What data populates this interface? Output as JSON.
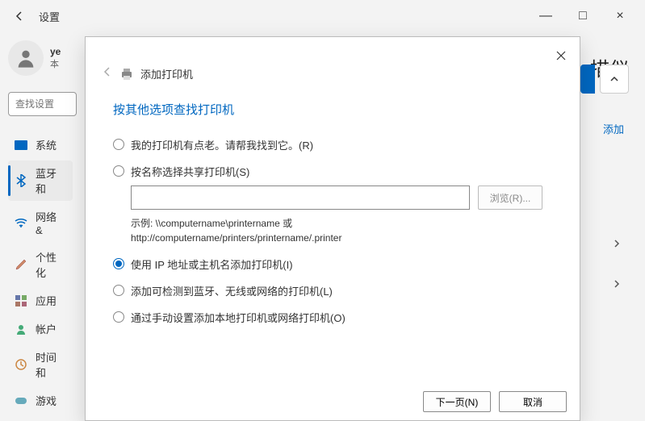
{
  "window": {
    "back_aria": "返回",
    "title": "设置",
    "minimize": "—",
    "maximize": "□",
    "close": "×"
  },
  "user": {
    "name_partial": "ye",
    "sub_partial": "本"
  },
  "search": {
    "placeholder": "查找设置"
  },
  "sidebar": {
    "items": [
      {
        "label": "系统",
        "icon": "system"
      },
      {
        "label": "蓝牙和",
        "icon": "bluetooth",
        "active": true
      },
      {
        "label": "网络 &",
        "icon": "wifi"
      },
      {
        "label": "个性化",
        "icon": "brush"
      },
      {
        "label": "应用",
        "icon": "apps"
      },
      {
        "label": "帐户",
        "icon": "account"
      },
      {
        "label": "时间和",
        "icon": "time"
      },
      {
        "label": "游戏",
        "icon": "game"
      }
    ]
  },
  "right": {
    "title_partial": "描仪",
    "add_label": "添加"
  },
  "dialog": {
    "title": "添加打印机",
    "heading": "按其他选项查找打印机",
    "options": [
      {
        "label": "我的打印机有点老。请帮我找到它。(R)",
        "checked": false
      },
      {
        "label": "按名称选择共享打印机(S)",
        "checked": false
      },
      {
        "label": "使用 IP 地址或主机名添加打印机(I)",
        "checked": true
      },
      {
        "label": "添加可检测到蓝牙、无线或网络的打印机(L)",
        "checked": false
      },
      {
        "label": "通过手动设置添加本地打印机或网络打印机(O)",
        "checked": false
      }
    ],
    "browse_label": "浏览(R)...",
    "example_line1": "示例: \\\\computername\\printername 或",
    "example_line2": "http://computername/printers/printername/.printer",
    "next_label": "下一页(N)",
    "cancel_label": "取消"
  }
}
